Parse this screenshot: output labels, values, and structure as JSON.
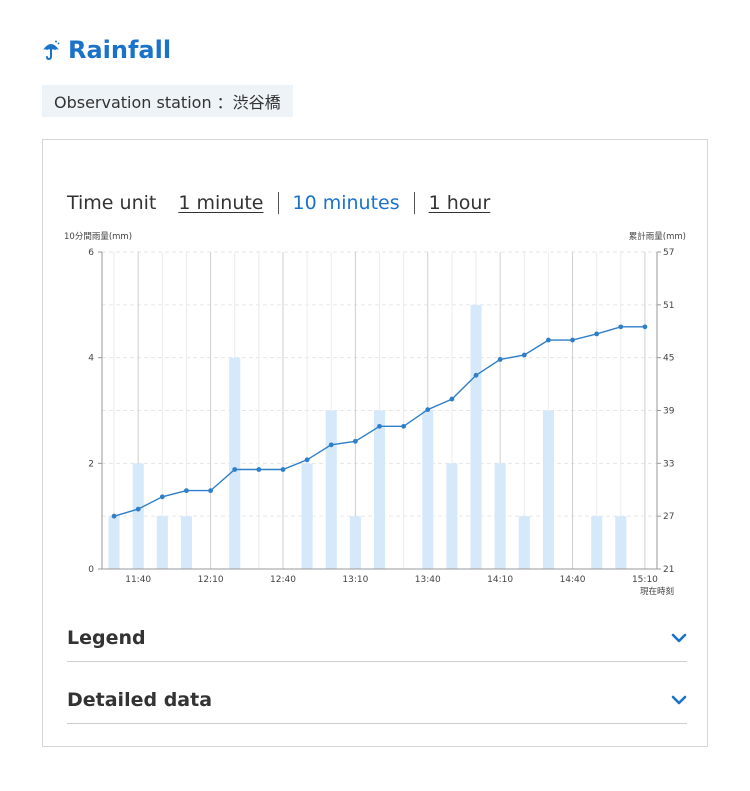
{
  "header": {
    "title": "Rainfall",
    "station_label": "Observation station ：渋谷橋"
  },
  "time_unit": {
    "label": "Time unit",
    "options": [
      {
        "label": "1 minute",
        "active": false
      },
      {
        "label": "10 minutes",
        "active": true
      },
      {
        "label": "1 hour",
        "active": false
      }
    ]
  },
  "chart_data": {
    "type": "bar",
    "title": "",
    "left_axis_label": "10分間雨量(mm)",
    "right_axis_label": "累計雨量(mm)",
    "current_time_label": "現在時刻",
    "left_ylim": [
      0,
      6
    ],
    "left_ticks": [
      0,
      2,
      4,
      6
    ],
    "right_ylim": [
      21,
      57
    ],
    "right_ticks": [
      21,
      27,
      33,
      39,
      45,
      51,
      57
    ],
    "x_tick_labels": [
      "11:40",
      "12:10",
      "12:40",
      "13:10",
      "13:40",
      "14:10",
      "14:40",
      "15:10"
    ],
    "x": [
      "11:30",
      "11:40",
      "11:50",
      "12:00",
      "12:10",
      "12:20",
      "12:30",
      "12:40",
      "12:50",
      "13:00",
      "13:10",
      "13:20",
      "13:30",
      "13:40",
      "13:50",
      "14:00",
      "14:10",
      "14:20",
      "14:30",
      "14:40",
      "14:50",
      "15:00",
      "15:10"
    ],
    "series": [
      {
        "values": [
          1,
          2,
          1,
          1,
          0,
          4,
          0,
          0,
          2,
          3,
          1,
          3,
          0,
          3,
          2,
          5,
          2,
          1,
          3,
          0,
          1,
          1,
          0
        ]
      },
      {
        "values": [
          27,
          27.8,
          29.2,
          29.9,
          29.9,
          32.3,
          32.3,
          32.3,
          33.4,
          35.1,
          35.5,
          37.2,
          37.2,
          39.1,
          40.3,
          43,
          44.8,
          45.3,
          47,
          47,
          47.7,
          48.5,
          48.5
        ]
      }
    ],
    "colors": {
      "bar": "#d6e9fb",
      "line": "#2f7fc8",
      "grid": "#e6e6e6",
      "vgrid": "#cfcfcf"
    }
  },
  "accordions": [
    {
      "label": "Legend"
    },
    {
      "label": "Detailed data"
    }
  ],
  "colors": {
    "accent": "#1a73c9"
  }
}
